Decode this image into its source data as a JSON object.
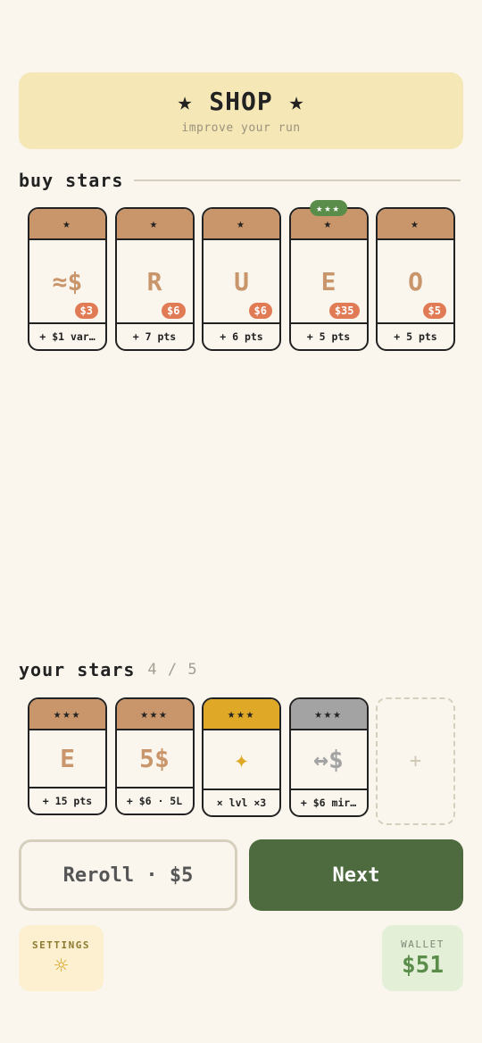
{
  "header": {
    "title": "★ SHOP ★",
    "subtitle": "improve your run"
  },
  "shop": {
    "title": "buy stars",
    "cards": [
      {
        "stars": "★",
        "glyph": "≈$",
        "price": "$3",
        "effect": "+ $1 var…",
        "tier": "",
        "color": "#c9956a"
      },
      {
        "stars": "★",
        "glyph": "R",
        "price": "$6",
        "effect": "+ 7 pts",
        "tier": "",
        "color": "#c9956a"
      },
      {
        "stars": "★",
        "glyph": "U",
        "price": "$6",
        "effect": "+ 6 pts",
        "tier": "",
        "color": "#c9956a"
      },
      {
        "stars": "★",
        "glyph": "E",
        "price": "$35",
        "effect": "+ 5 pts",
        "tier": "★★★",
        "color": "#c9956a"
      },
      {
        "stars": "★",
        "glyph": "O",
        "price": "$5",
        "effect": "+ 5 pts",
        "tier": "",
        "color": "#c9956a"
      }
    ]
  },
  "inventory": {
    "title": "your stars",
    "count": "4 / 5",
    "empty_slot": "+",
    "cards": [
      {
        "stars": "★★★",
        "glyph": "E",
        "effect": "+ 15 pts",
        "color": "#c9956a"
      },
      {
        "stars": "★★★",
        "glyph": "5$",
        "effect": "+ $6 · 5L",
        "color": "#c9956a"
      },
      {
        "stars": "★★★",
        "glyph": "✦",
        "effect": "× lvl ×3",
        "color": "#e0a827"
      },
      {
        "stars": "★★★",
        "glyph": "↔$",
        "effect": "+ $6 mir…",
        "color": "#a3a3a3"
      }
    ]
  },
  "actions": {
    "reroll_label": "Reroll · $5",
    "next_label": "Next"
  },
  "settings": {
    "label": "SETTINGS",
    "icon": "gear-icon"
  },
  "wallet": {
    "label": "WALLET",
    "value": "$51"
  }
}
